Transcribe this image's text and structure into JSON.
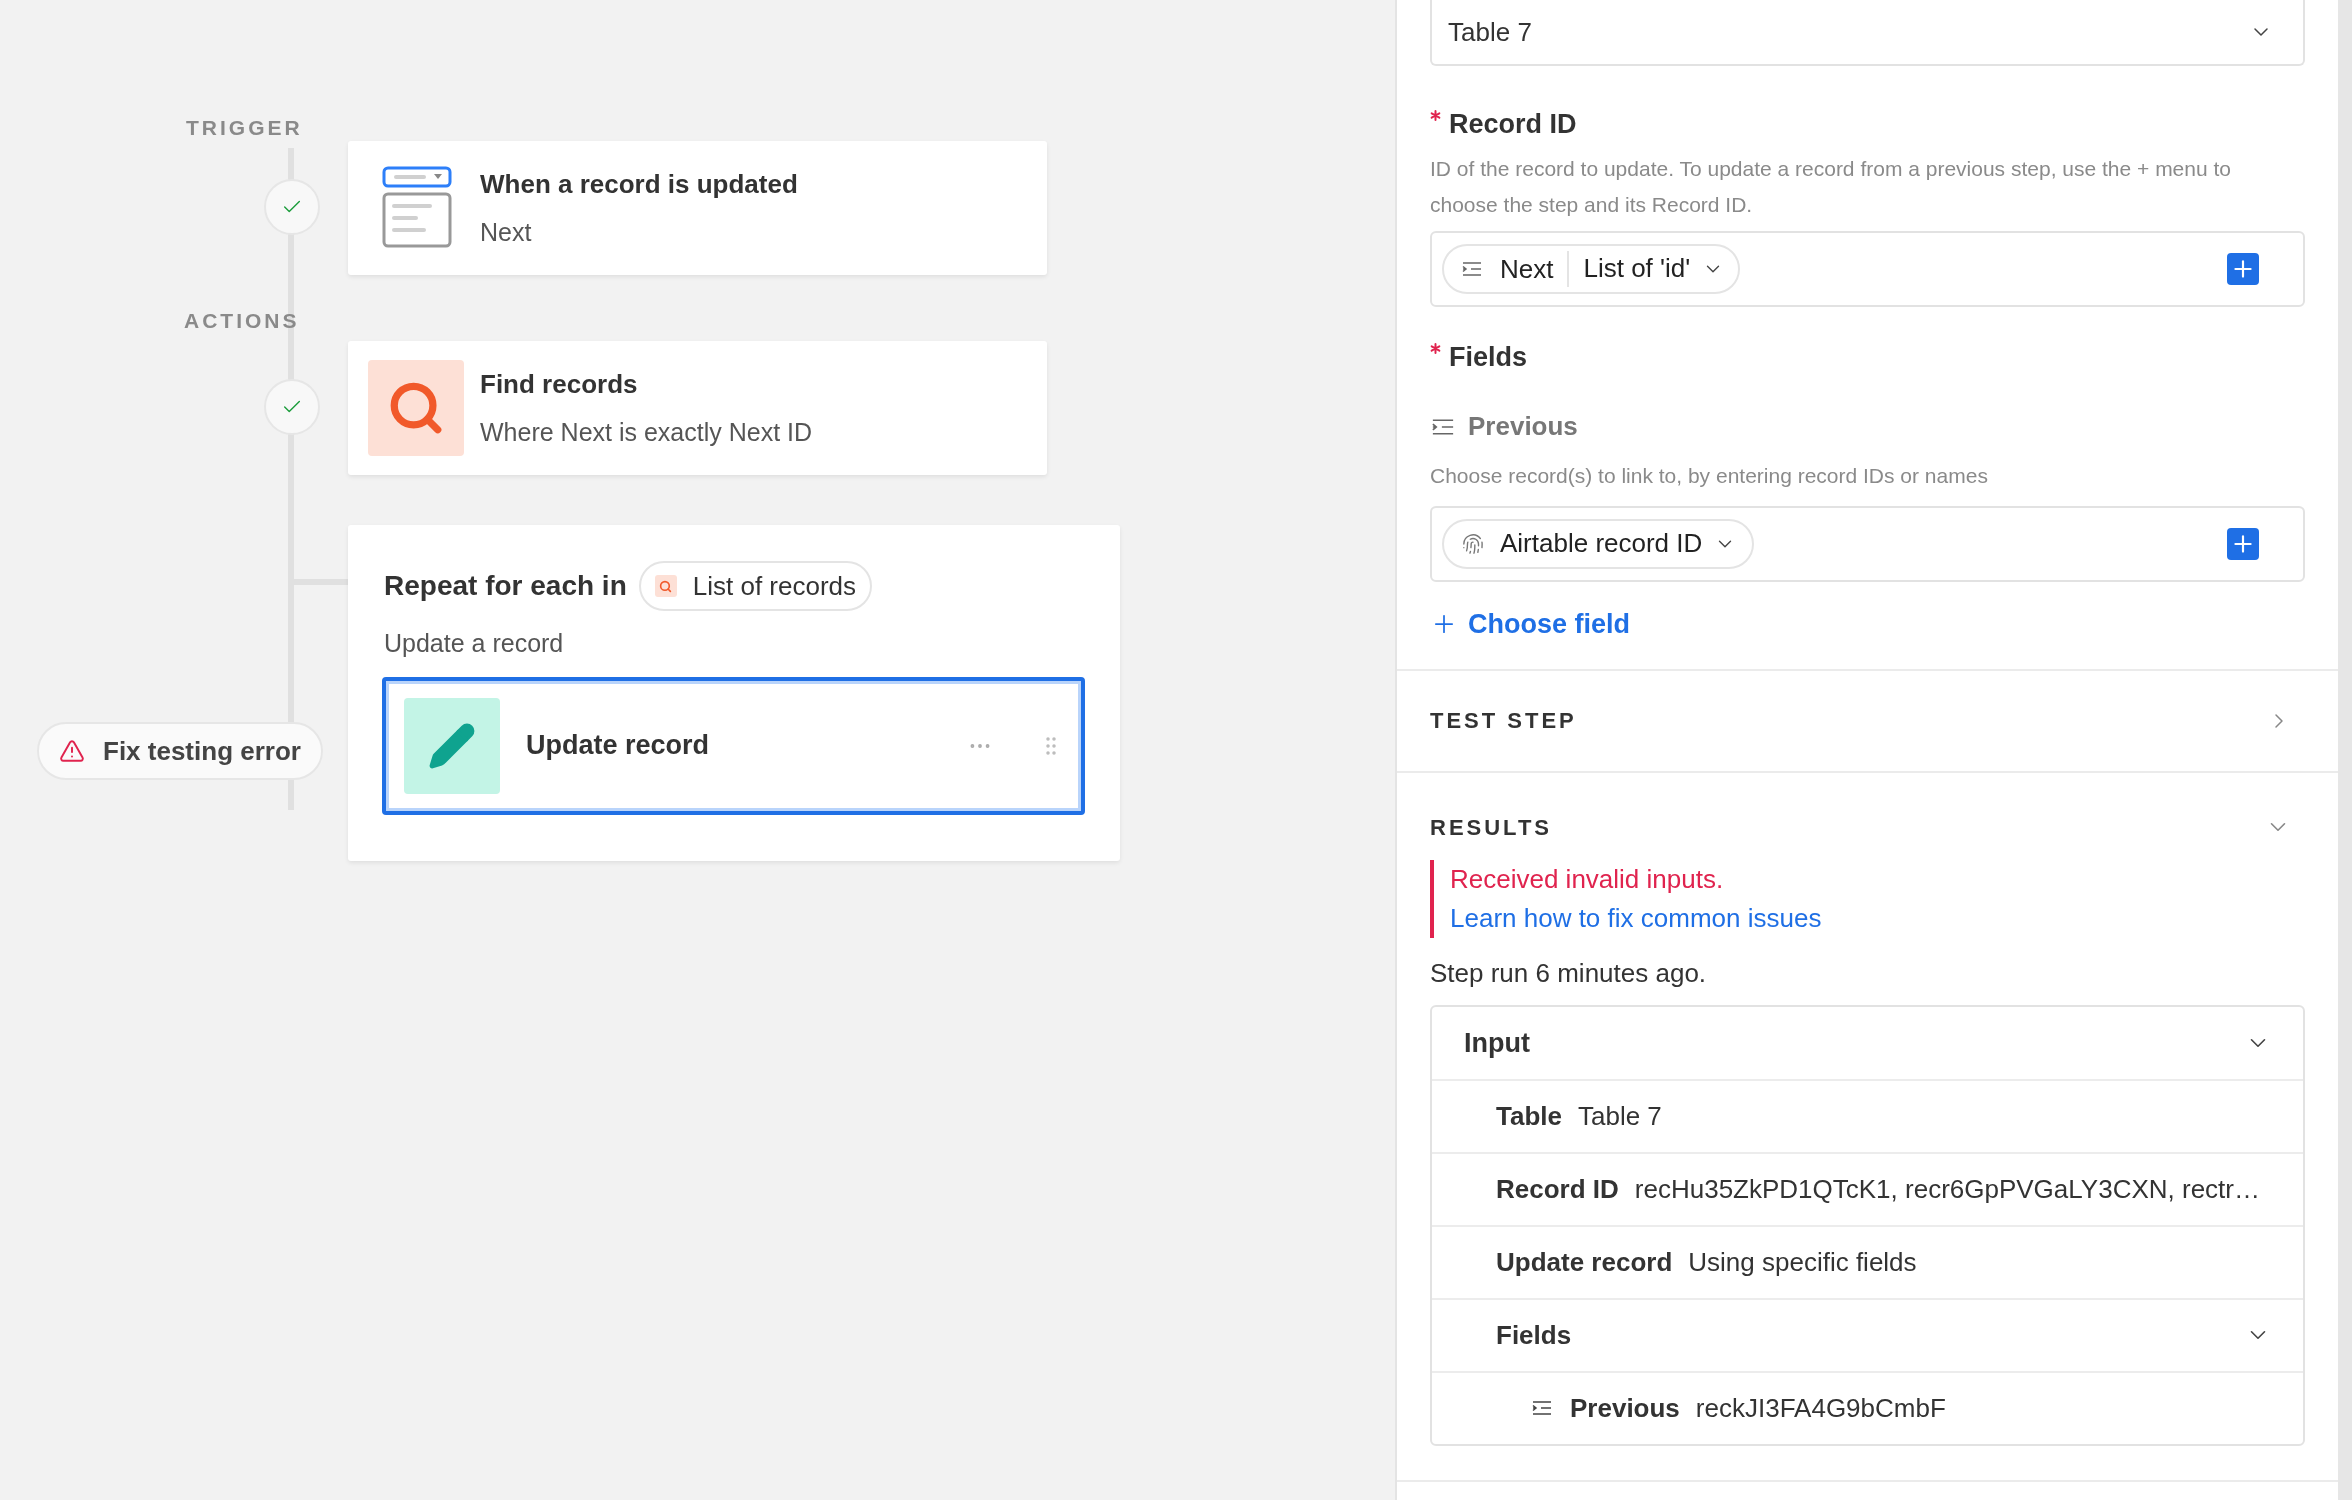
{
  "canvas": {
    "trigger": {
      "heading": "TRIGGER",
      "completed": true,
      "title": "When a record is updated",
      "subtitle": "Next"
    },
    "actions_heading": "ACTIONS",
    "find_step": {
      "completed": true,
      "title": "Find records",
      "subtitle": "Where Next is exactly Next ID"
    },
    "repeat": {
      "label": "Repeat for each in",
      "source": "List of records",
      "subheading": "Update a record",
      "step": {
        "title": "Update record",
        "selected": true
      }
    },
    "error_button": "Fix testing error"
  },
  "panel": {
    "table_select": {
      "value": "Table 7"
    },
    "record_id": {
      "label": "Record ID",
      "required": true,
      "help": "ID of the record to update. To update a record from a previous step, use the + menu to choose the step and its Record ID.",
      "tokens": [
        {
          "kind": "step_output",
          "step": "Next",
          "value": "List of 'id'"
        }
      ]
    },
    "fields": {
      "label": "Fields",
      "required": true,
      "items": [
        {
          "label": "Previous",
          "help": "Choose record(s) to link to, by entering record IDs or names",
          "tokens": [
            {
              "kind": "record_id",
              "value": "Airtable record ID"
            }
          ]
        }
      ]
    },
    "choose_field": "Choose field",
    "test_step": {
      "title": "TEST STEP",
      "expanded": false
    },
    "results": {
      "title": "RESULTS",
      "expanded": true,
      "error": "Received invalid inputs.",
      "help_link": "Learn how to fix common issues",
      "run_time": "Step run 6 minutes ago.",
      "input": {
        "title": "Input",
        "expanded": true,
        "rows": [
          {
            "kind": "value",
            "label": "Table",
            "value": "Table 7"
          },
          {
            "kind": "value",
            "label": "Record ID",
            "value": "recHu35ZkPD1QTcK1, recr6GpPVGaLY3CXN, rectr…"
          },
          {
            "kind": "value",
            "label": "Update record",
            "value": "Using specific fields"
          },
          {
            "kind": "group",
            "label": "Fields",
            "expanded": true,
            "children": [
              {
                "label": "Previous",
                "value": "reckJI3FA4G9bCmbF"
              }
            ]
          }
        ]
      }
    }
  }
}
